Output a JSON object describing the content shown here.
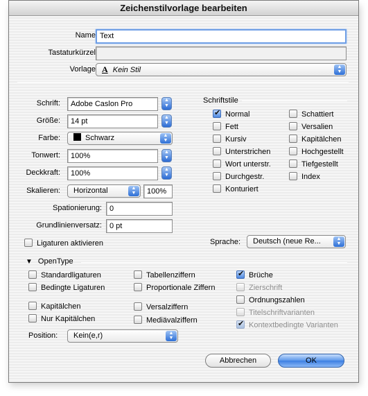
{
  "window": {
    "title": "Zeichenstilvorlage bearbeiten"
  },
  "top": {
    "name_label": "Name:",
    "name_value": "Text",
    "shortcut_label": "Tastaturkürzel:",
    "shortcut_value": "",
    "basedon_label": "Vorlage:",
    "basedon_icon": "A",
    "basedon_value": "Kein Stil"
  },
  "font": {
    "font_label": "Schrift:",
    "font_value": "Adobe Caslon Pro",
    "size_label": "Größe:",
    "size_value": "14 pt",
    "color_label": "Farbe:",
    "color_value": "Schwarz",
    "color_swatch": "#000000",
    "tint_label": "Tonwert:",
    "tint_value": "100%",
    "opacity_label": "Deckkraft:",
    "opacity_value": "100%",
    "scale_label": "Skalieren:",
    "scale_mode": "Horizontal",
    "scale_value": "100%",
    "tracking_label": "Spationierung:",
    "tracking_value": "0",
    "baseline_label": "Grundlinienversatz:",
    "baseline_value": "0 pt"
  },
  "styles": {
    "group_label": "Schriftstile",
    "left": [
      {
        "label": "Normal",
        "checked": true
      },
      {
        "label": "Fett",
        "checked": false
      },
      {
        "label": "Kursiv",
        "checked": false
      },
      {
        "label": "Unterstrichen",
        "checked": false
      },
      {
        "label": "Wort unterstr.",
        "checked": false
      },
      {
        "label": "Durchgestr.",
        "checked": false
      },
      {
        "label": "Konturiert",
        "checked": false
      }
    ],
    "right": [
      {
        "label": "Schattiert",
        "checked": false
      },
      {
        "label": "Versalien",
        "checked": false
      },
      {
        "label": "Kapitälchen",
        "checked": false
      },
      {
        "label": "Hochgestellt",
        "checked": false
      },
      {
        "label": "Tiefgestellt",
        "checked": false
      },
      {
        "label": "Index",
        "checked": false
      }
    ]
  },
  "ligatures": {
    "label": "Ligaturen aktivieren",
    "checked": false
  },
  "language": {
    "label": "Sprache:",
    "value": "Deutsch (neue Re..."
  },
  "opentype": {
    "label": "OpenType",
    "col1": [
      {
        "label": "Standardligaturen",
        "checked": false
      },
      {
        "label": "Bedingte Ligaturen",
        "checked": false
      },
      {
        "label": "Kapitälchen",
        "checked": false
      },
      {
        "label": "Nur Kapitälchen",
        "checked": false
      }
    ],
    "col2": [
      {
        "label": "Tabellenziffern",
        "checked": false
      },
      {
        "label": "Proportionale Ziffern",
        "checked": false
      },
      {
        "label": "Versalziffern",
        "checked": false
      },
      {
        "label": "Mediävalziffern",
        "checked": false
      }
    ],
    "col3": [
      {
        "label": "Brüche",
        "checked": true,
        "disabled": false
      },
      {
        "label": "Zierschrift",
        "checked": false,
        "disabled": true
      },
      {
        "label": "Ordnungszahlen",
        "checked": false,
        "disabled": false
      },
      {
        "label": "Titelschriftvarianten",
        "checked": false,
        "disabled": true
      },
      {
        "label": "Kontextbedingte Varianten",
        "checked": true,
        "disabled": true
      }
    ],
    "position_label": "Position:",
    "position_value": "Kein(e,r)"
  },
  "buttons": {
    "cancel": "Abbrechen",
    "ok": "OK"
  }
}
